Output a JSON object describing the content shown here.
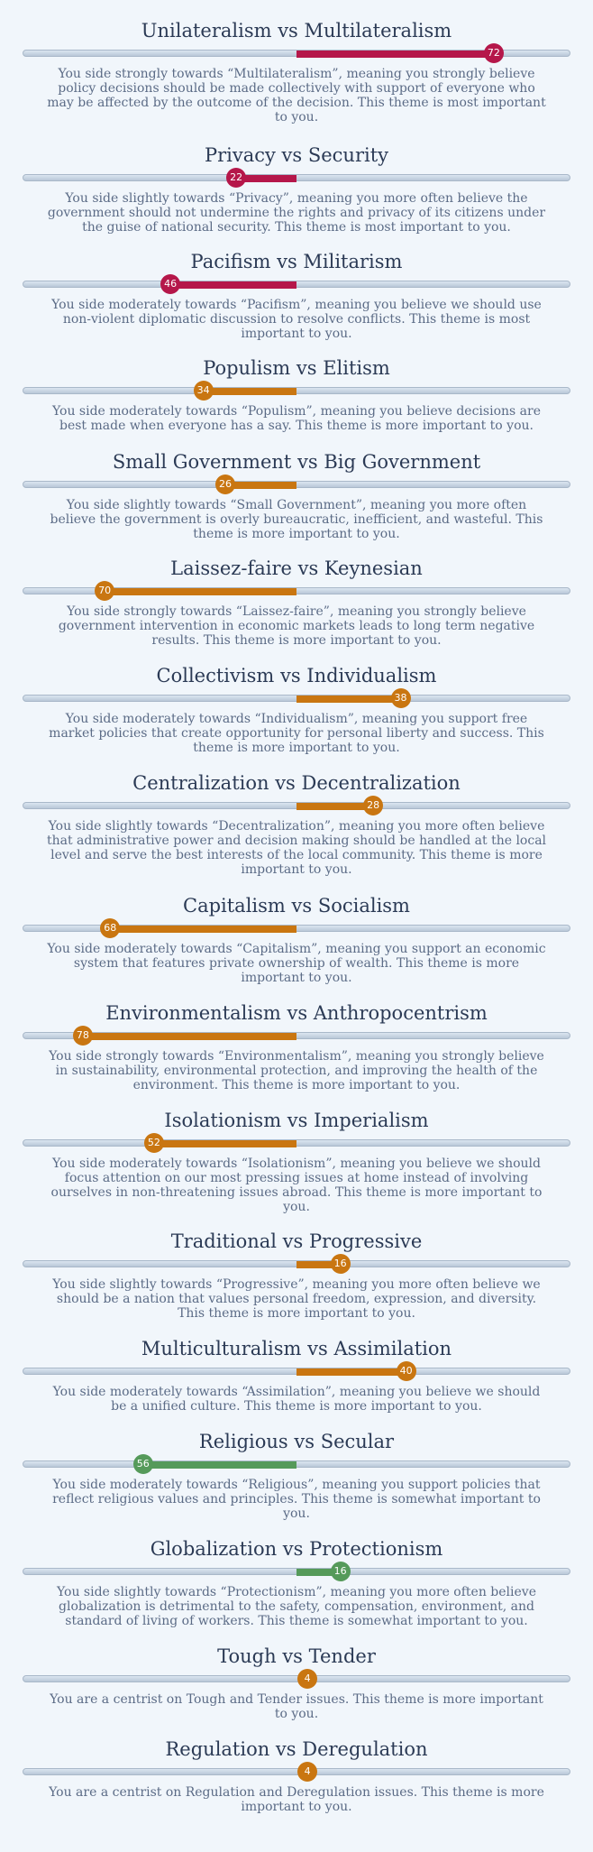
{
  "colors": {
    "red": "#b5174a",
    "orange": "#c97611",
    "green": "#559a5a"
  },
  "themes": [
    {
      "title": "Unilateralism vs Multilateralism",
      "value": 72,
      "side": "right",
      "color": "red",
      "description": "You side strongly towards “Multilateralism”, meaning you strongly believe policy decisions should be made collectively with support of everyone who may be affected by the outcome of the decision. This theme is most important to you."
    },
    {
      "title": "Privacy vs Security",
      "value": 22,
      "side": "left",
      "color": "red",
      "description": "You side slightly towards “Privacy”, meaning you more often believe the government should not undermine the rights and privacy of its citizens under the guise of national security. This theme is most important to you."
    },
    {
      "title": "Pacifism vs Militarism",
      "value": 46,
      "side": "left",
      "color": "red",
      "description": "You side moderately towards “Pacifism”, meaning you believe we should use non-violent diplomatic discussion to resolve conflicts. This theme is most important to you."
    },
    {
      "title": "Populism vs Elitism",
      "value": 34,
      "side": "left",
      "color": "orange",
      "description": "You side moderately towards “Populism”, meaning you believe decisions are best made when everyone has a say. This theme is more important to you."
    },
    {
      "title": "Small Government vs Big Government",
      "value": 26,
      "side": "left",
      "color": "orange",
      "description": "You side slightly towards “Small Government”, meaning you more often believe the government is overly bureaucratic, inefficient, and wasteful. This theme is more important to you."
    },
    {
      "title": "Laissez-faire vs Keynesian",
      "value": 70,
      "side": "left",
      "color": "orange",
      "description": "You side strongly towards “Laissez-faire”, meaning you strongly believe government intervention in economic markets leads to long term negative results. This theme is more important to you."
    },
    {
      "title": "Collectivism vs Individualism",
      "value": 38,
      "side": "right",
      "color": "orange",
      "description": "You side moderately towards “Individualism”, meaning you support free market policies that create opportunity for personal liberty and success. This theme is more important to you."
    },
    {
      "title": "Centralization vs Decentralization",
      "value": 28,
      "side": "right",
      "color": "orange",
      "description": "You side slightly towards “Decentralization”, meaning you more often believe that administrative power and decision making should be handled at the local level and serve the best interests of the local community. This theme is more important to you."
    },
    {
      "title": "Capitalism vs Socialism",
      "value": 68,
      "side": "left",
      "color": "orange",
      "description": "You side moderately towards “Capitalism”, meaning you support an economic system that features private ownership of wealth. This theme is more important to you."
    },
    {
      "title": "Environmentalism vs Anthropocentrism",
      "value": 78,
      "side": "left",
      "color": "orange",
      "description": "You side strongly towards “Environmentalism”, meaning you strongly believe in sustainability, environmental protection, and improving the health of the environment. This theme is more important to you."
    },
    {
      "title": "Isolationism vs Imperialism",
      "value": 52,
      "side": "left",
      "color": "orange",
      "description": "You side moderately towards “Isolationism”, meaning you believe we should focus attention on our most pressing issues at home instead of involving ourselves in non-threatening issues abroad. This theme is more important to you."
    },
    {
      "title": "Traditional vs Progressive",
      "value": 16,
      "side": "right",
      "color": "orange",
      "description": "You side slightly towards “Progressive”, meaning you more often believe we should be a nation that values personal freedom, expression, and diversity. This theme is more important to you."
    },
    {
      "title": "Multiculturalism vs Assimilation",
      "value": 40,
      "side": "right",
      "color": "orange",
      "description": "You side moderately towards “Assimilation”, meaning you believe we should be a unified culture. This theme is more important to you."
    },
    {
      "title": "Religious vs Secular",
      "value": 56,
      "side": "left",
      "color": "green",
      "description": "You side moderately towards “Religious”, meaning you support policies that reflect religious values and principles. This theme is somewhat important to you."
    },
    {
      "title": "Globalization vs Protectionism",
      "value": 16,
      "side": "right",
      "color": "green",
      "description": "You side slightly towards “Protectionism”, meaning you more often believe globalization is detrimental to the safety, compensation, environment, and standard of living of workers. This theme is somewhat important to you."
    },
    {
      "title": "Tough vs Tender",
      "value": 4,
      "side": "center",
      "color": "orange",
      "description": "You are a centrist on Tough and Tender issues. This theme is more important to you."
    },
    {
      "title": "Regulation vs Deregulation",
      "value": 4,
      "side": "center",
      "color": "orange",
      "description": "You are a centrist on Regulation and Deregulation issues. This theme is more important to you."
    }
  ]
}
